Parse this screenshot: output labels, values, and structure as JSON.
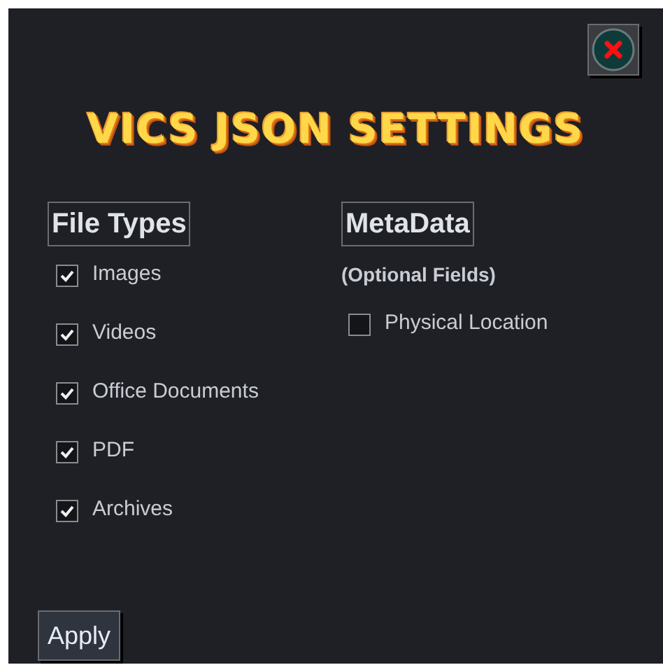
{
  "title": "VICS JSON SETTINGS",
  "file_types": {
    "heading": "File Types",
    "items": [
      {
        "label": "Images",
        "checked": true
      },
      {
        "label": "Videos",
        "checked": true
      },
      {
        "label": "Office Documents",
        "checked": true
      },
      {
        "label": "PDF",
        "checked": true
      },
      {
        "label": "Archives",
        "checked": true
      }
    ]
  },
  "metadata": {
    "heading": "MetaData",
    "note": "(Optional Fields)",
    "items": [
      {
        "label": "Physical Location",
        "checked": false
      }
    ]
  },
  "buttons": [
    "Apply"
  ]
}
